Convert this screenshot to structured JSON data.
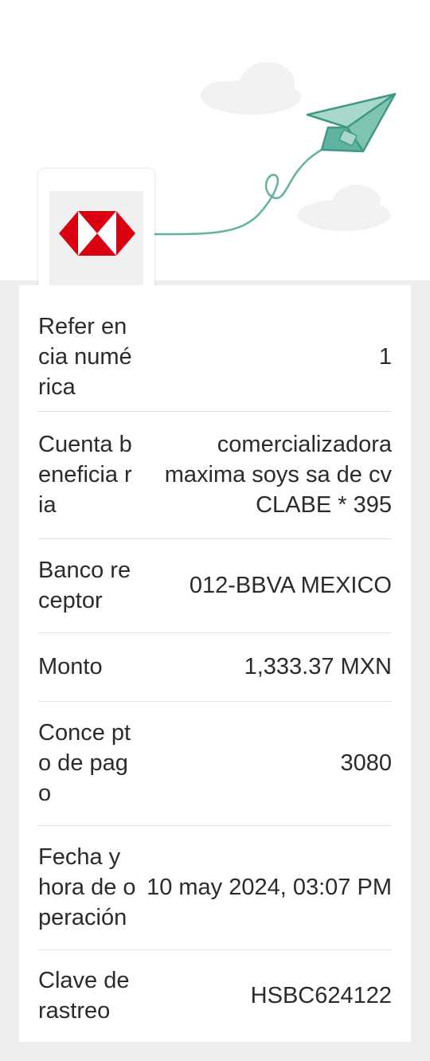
{
  "colors": {
    "brand_red": "#db0011",
    "plane_teal": "#5fb3a0",
    "background_gray": "#eeeeee"
  },
  "hero": {
    "logo_icon": "hsbc-hexagon-logo",
    "illustration_icon": "paper-plane-icon"
  },
  "details": [
    {
      "label": "Refer encia numérica",
      "value": "1"
    },
    {
      "label": "Cuenta beneficia ria",
      "value": "comercializadora maxima soys sa de cv CLABE * 395"
    },
    {
      "label": "Banco receptor",
      "value": "012-BBVA MEXICO"
    },
    {
      "label": "Monto",
      "value": "1,333.37 MXN"
    },
    {
      "label": "Conce pto de pago",
      "value": "3080"
    },
    {
      "label": "Fecha y hora de o peración",
      "value": "10 may 2024, 03:07 PM"
    },
    {
      "label": "Clave de rastreo",
      "value": "HSBC624122"
    }
  ]
}
